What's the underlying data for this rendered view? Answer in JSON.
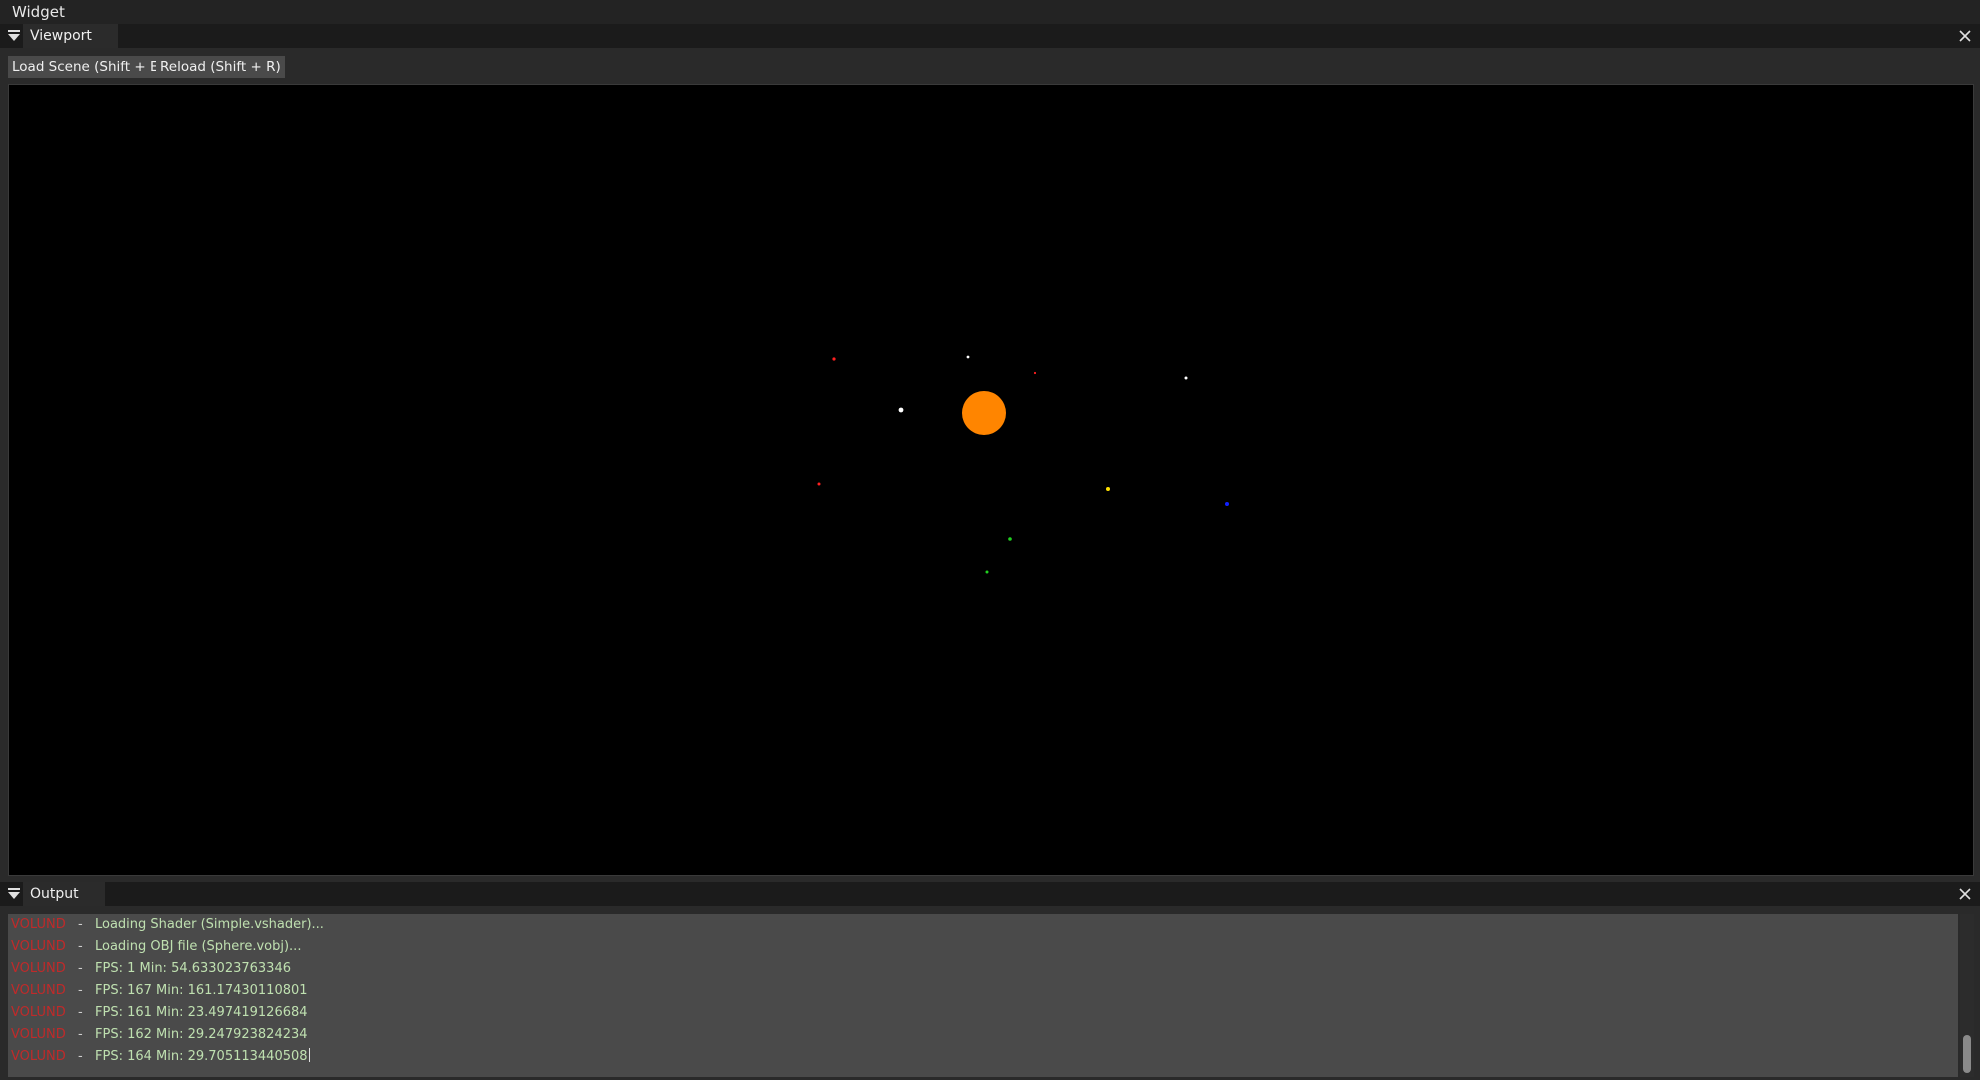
{
  "menubar": {
    "title": "Widget"
  },
  "viewport_panel": {
    "tab_label": "Viewport",
    "buttons": {
      "load_scene": "Load Scene (Shift + E)",
      "reload": "Reload (Shift + R)"
    }
  },
  "scene": {
    "background": "#000000",
    "sun_color": "#ff8500",
    "planet_colors": {
      "red": "#ff2020",
      "white": "#ffffff",
      "yellow": "#ffe000",
      "blue": "#1020ff",
      "green": "#20d020"
    }
  },
  "output_panel": {
    "tab_label": "Output",
    "log": [
      {
        "source": "VOLUND",
        "sep": "-",
        "message": "Loading Shader (Simple.vshader)..."
      },
      {
        "source": "VOLUND",
        "sep": "-",
        "message": "Loading OBJ file (Sphere.vobj)..."
      },
      {
        "source": "VOLUND",
        "sep": "-",
        "message": "FPS: 1 Min: 54.633023763346"
      },
      {
        "source": "VOLUND",
        "sep": "-",
        "message": "FPS: 167 Min: 161.17430110801"
      },
      {
        "source": "VOLUND",
        "sep": "-",
        "message": "FPS: 161 Min: 23.497419126684"
      },
      {
        "source": "VOLUND",
        "sep": "-",
        "message": "FPS: 162 Min: 29.247923824234"
      },
      {
        "source": "VOLUND",
        "sep": "-",
        "message": "FPS: 164 Min: 29.705113440508"
      }
    ]
  }
}
